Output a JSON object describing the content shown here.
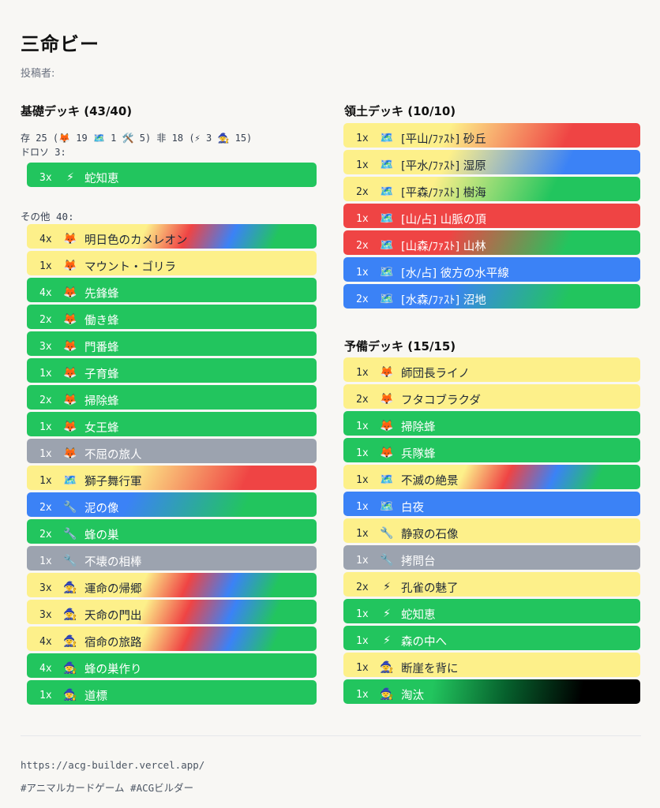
{
  "deck": {
    "title": "三命ビー",
    "poster": "投稿者:"
  },
  "base": {
    "heading": "基礎デッキ (43/40)",
    "summary_line1": "存 25 (🦊 19 🗺️ 1 🛠️ 5) 非 18 (⚡ 3 🧙 15)",
    "summary_line2": "ドロソ 3:",
    "group2": "その他 40:",
    "draw": [
      {
        "qty": "3x",
        "icon": "⚡",
        "name": "蛇知恵",
        "theme": "green"
      }
    ],
    "other": [
      {
        "qty": "4x",
        "icon": "🦊",
        "name": "明日色のカメレオン",
        "theme": "rainbow"
      },
      {
        "qty": "1x",
        "icon": "🦊",
        "name": "マウント・ゴリラ",
        "theme": "yellow"
      },
      {
        "qty": "4x",
        "icon": "🦊",
        "name": "先鋒蜂",
        "theme": "green"
      },
      {
        "qty": "2x",
        "icon": "🦊",
        "name": "働き蜂",
        "theme": "green"
      },
      {
        "qty": "3x",
        "icon": "🦊",
        "name": "門番蜂",
        "theme": "green"
      },
      {
        "qty": "1x",
        "icon": "🦊",
        "name": "子育蜂",
        "theme": "green"
      },
      {
        "qty": "2x",
        "icon": "🦊",
        "name": "掃除蜂",
        "theme": "green"
      },
      {
        "qty": "1x",
        "icon": "🦊",
        "name": "女王蜂",
        "theme": "green"
      },
      {
        "qty": "1x",
        "icon": "🦊",
        "name": "不屈の旅人",
        "theme": "gray"
      },
      {
        "qty": "1x",
        "icon": "🗺️",
        "name": "獅子舞行軍",
        "theme": "yellow-red"
      },
      {
        "qty": "2x",
        "icon": "🔧",
        "name": "泥の像",
        "theme": "blue-green"
      },
      {
        "qty": "2x",
        "icon": "🔧",
        "name": "蜂の巣",
        "theme": "green"
      },
      {
        "qty": "1x",
        "icon": "🔧",
        "name": "不壊の相棒",
        "theme": "gray"
      },
      {
        "qty": "3x",
        "icon": "🧙",
        "name": "運命の帰郷",
        "theme": "rainbow"
      },
      {
        "qty": "3x",
        "icon": "🧙",
        "name": "天命の門出",
        "theme": "rainbow"
      },
      {
        "qty": "4x",
        "icon": "🧙",
        "name": "宿命の旅路",
        "theme": "rainbow"
      },
      {
        "qty": "4x",
        "icon": "🧙",
        "name": "蜂の巣作り",
        "theme": "green"
      },
      {
        "qty": "1x",
        "icon": "🧙",
        "name": "道標",
        "theme": "green"
      }
    ]
  },
  "territory": {
    "heading": "領土デッキ (10/10)",
    "items": [
      {
        "qty": "1x",
        "icon": "🗺️",
        "name": "[平山/ﾌｧｽﾄ] 砂丘",
        "theme": "yellow-red"
      },
      {
        "qty": "1x",
        "icon": "🗺️",
        "name": "[平水/ﾌｧｽﾄ] 湿原",
        "theme": "yellow-blue"
      },
      {
        "qty": "2x",
        "icon": "🗺️",
        "name": "[平森/ﾌｧｽﾄ] 樹海",
        "theme": "yellow-green"
      },
      {
        "qty": "1x",
        "icon": "🗺️",
        "name": "[山/占] 山脈の頂",
        "theme": "red"
      },
      {
        "qty": "2x",
        "icon": "🗺️",
        "name": "[山森/ﾌｧｽﾄ] 山林",
        "theme": "red-green"
      },
      {
        "qty": "1x",
        "icon": "🗺️",
        "name": "[水/占] 彼方の水平線",
        "theme": "blue"
      },
      {
        "qty": "2x",
        "icon": "🗺️",
        "name": "[水森/ﾌｧｽﾄ] 沼地",
        "theme": "blue-green"
      }
    ]
  },
  "reserve": {
    "heading": "予備デッキ (15/15)",
    "items": [
      {
        "qty": "1x",
        "icon": "🦊",
        "name": "師団長ライノ",
        "theme": "yellow"
      },
      {
        "qty": "2x",
        "icon": "🦊",
        "name": "フタコブラクダ",
        "theme": "yellow"
      },
      {
        "qty": "1x",
        "icon": "🦊",
        "name": "掃除蜂",
        "theme": "green"
      },
      {
        "qty": "1x",
        "icon": "🦊",
        "name": "兵隊蜂",
        "theme": "green"
      },
      {
        "qty": "1x",
        "icon": "🗺️",
        "name": "不滅の絶景",
        "theme": "rainbow"
      },
      {
        "qty": "1x",
        "icon": "🗺️",
        "name": "白夜",
        "theme": "blue"
      },
      {
        "qty": "1x",
        "icon": "🔧",
        "name": "静寂の石像",
        "theme": "yellow"
      },
      {
        "qty": "1x",
        "icon": "🔧",
        "name": "拷問台",
        "theme": "gray"
      },
      {
        "qty": "2x",
        "icon": "⚡",
        "name": "孔雀の魅了",
        "theme": "yellow"
      },
      {
        "qty": "1x",
        "icon": "⚡",
        "name": "蛇知恵",
        "theme": "green"
      },
      {
        "qty": "1x",
        "icon": "⚡",
        "name": "森の中へ",
        "theme": "green"
      },
      {
        "qty": "1x",
        "icon": "🧙",
        "name": "断崖を背に",
        "theme": "yellow"
      },
      {
        "qty": "1x",
        "icon": "🧙",
        "name": "淘汰",
        "theme": "green-black"
      }
    ]
  },
  "footer": {
    "url": "https://acg-builder.vercel.app/",
    "tags": "#アニマルカードゲーム #ACGビルダー"
  },
  "colors": {
    "green": "#22c55e",
    "yellow": "#fdf08a",
    "red": "#ef4444",
    "blue": "#3b82f6",
    "gray": "#9ca3af",
    "black": "#000000"
  }
}
